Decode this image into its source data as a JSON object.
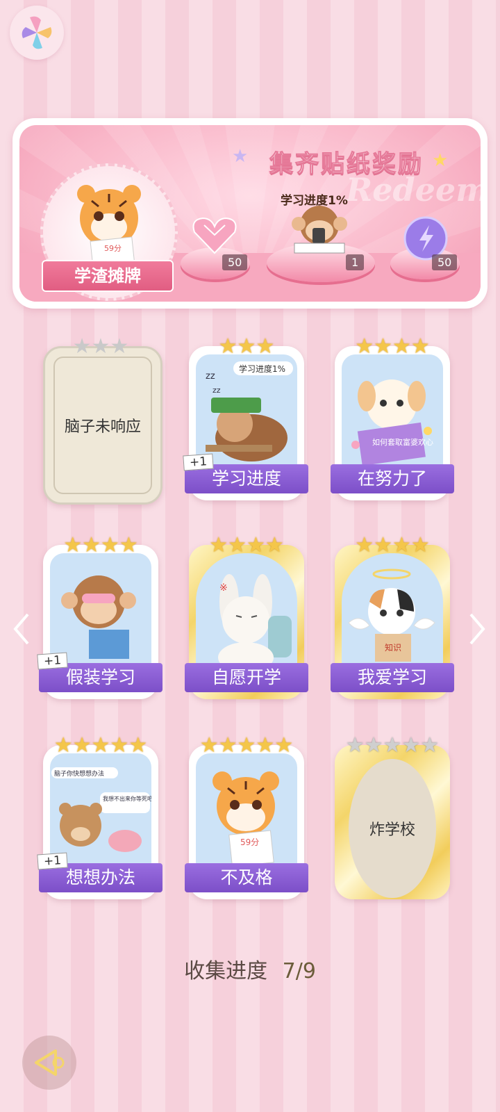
{
  "banner": {
    "title": "集齐贴纸奖励",
    "watermark": "Redeem",
    "ribbon_label": "学渣摊牌",
    "sticker_score": "59分",
    "progress_label": "学习进度1%",
    "rewards": [
      {
        "name": "heart-gem",
        "count": "50"
      },
      {
        "name": "monkey-sticker",
        "count": "1"
      },
      {
        "name": "energy-orb",
        "count": "50"
      }
    ]
  },
  "cards": [
    {
      "label": "脑子未响应",
      "stars": 3,
      "locked": true,
      "plus_one": false
    },
    {
      "label": "学习进度",
      "stars": 3,
      "locked": false,
      "plus_one": true,
      "bubble": "学习进度1%"
    },
    {
      "label": "在努力了",
      "stars": 4,
      "locked": false,
      "plus_one": false,
      "book": "如何套取富婆欢心"
    },
    {
      "label": "假装学习",
      "stars": 4,
      "locked": false,
      "plus_one": true
    },
    {
      "label": "自愿开学",
      "stars": 4,
      "locked": false,
      "plus_one": false
    },
    {
      "label": "我爱学习",
      "stars": 4,
      "locked": false,
      "plus_one": false,
      "book": "知识"
    },
    {
      "label": "想想办法",
      "stars": 5,
      "locked": false,
      "plus_one": true,
      "bubble1": "脑子你快想想办法",
      "bubble2": "我想不出来你等死吧"
    },
    {
      "label": "不及格",
      "stars": 5,
      "locked": false,
      "plus_one": false,
      "paper": "59分"
    },
    {
      "label": "炸学校",
      "stars": 5,
      "locked": true,
      "plus_one": false
    }
  ],
  "plus_one_text": "+1",
  "progress": {
    "label": "收集进度",
    "value": "7/9"
  },
  "colors": {
    "accent": "#8a5bd6",
    "gold": "#f4c64a",
    "pink": "#f39ab3"
  }
}
